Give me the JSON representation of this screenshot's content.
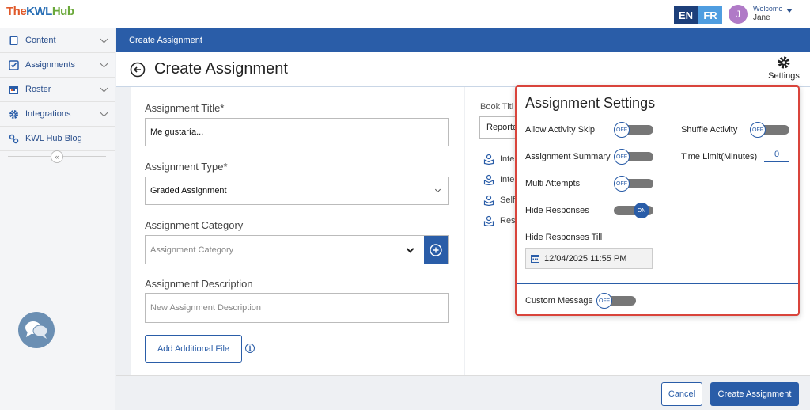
{
  "header": {
    "logo": {
      "the": "The",
      "kwl": "KWL",
      "hub": "Hub"
    },
    "lang_en": "EN",
    "lang_fr": "FR",
    "avatar_initial": "J",
    "welcome": "Welcome",
    "user_name": "Jane"
  },
  "sidebar": {
    "items": [
      {
        "label": "Content",
        "icon": "book-icon"
      },
      {
        "label": "Assignments",
        "icon": "checkbox-icon"
      },
      {
        "label": "Roster",
        "icon": "calendar-icon"
      },
      {
        "label": "Integrations",
        "icon": "gear-icon"
      },
      {
        "label": "KWL Hub Blog",
        "icon": "link-icon"
      }
    ],
    "collapse": "«"
  },
  "banner": {
    "text": "Create Assignment"
  },
  "page": {
    "title": "Create Assignment",
    "settings_label": "Settings"
  },
  "form": {
    "title_label": "Assignment Title*",
    "title_value": "Me gustaría...",
    "type_label": "Assignment Type*",
    "type_value": "Graded Assignment",
    "category_label": "Assignment Category",
    "category_placeholder": "Assignment Category",
    "description_label": "Assignment Description",
    "description_placeholder": "New Assignment Description",
    "add_file": "Add Additional File",
    "info": "i"
  },
  "right": {
    "book_label": "Book Titl",
    "book_value": "Reporte",
    "activities": [
      "Inte",
      "Inte",
      "Self",
      "Res"
    ]
  },
  "settings_popup": {
    "title": "Assignment Settings",
    "allow_skip": {
      "label": "Allow Activity Skip",
      "state": "OFF"
    },
    "summary": {
      "label": "Assignment Summary",
      "state": "OFF"
    },
    "multi": {
      "label": "Multi Attempts",
      "state": "OFF"
    },
    "hide": {
      "label": "Hide Responses",
      "state": "ON"
    },
    "hide_till_label": "Hide Responses Till",
    "hide_till_value": "12/04/2025 11:55 PM",
    "shuffle": {
      "label": "Shuffle Activity",
      "state": "OFF"
    },
    "time_limit_label": "Time Limit(Minutes)",
    "time_limit_value": "0",
    "custom": {
      "label": "Custom Message",
      "state": "OFF"
    }
  },
  "footer": {
    "cancel": "Cancel",
    "create": "Create Assignment"
  },
  "colors": {
    "primary": "#2a5da8",
    "popup_border": "#d9443b"
  }
}
